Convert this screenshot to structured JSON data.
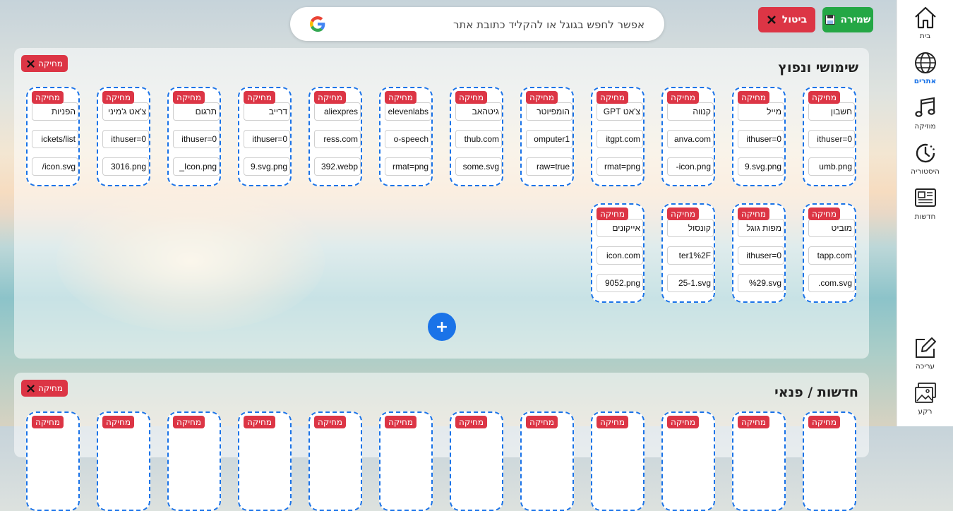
{
  "toolbar": {
    "save_label": "שמירה",
    "cancel_label": "ביטול"
  },
  "search": {
    "placeholder": "אפשר לחפש בגוגל או להקליד כתובת אתר"
  },
  "sidebar": {
    "items": [
      {
        "label": "בית",
        "icon": "home-icon"
      },
      {
        "label": "אתרים",
        "icon": "globe-icon",
        "active": true
      },
      {
        "label": "מוזיקה",
        "icon": "music-icon"
      },
      {
        "label": "היסטוריה",
        "icon": "history-icon"
      },
      {
        "label": "חדשות",
        "icon": "news-icon"
      },
      {
        "label": "עריכה",
        "icon": "edit-icon"
      },
      {
        "label": "רקע",
        "icon": "image-icon"
      }
    ]
  },
  "delete_label": "מחיקה",
  "panels": [
    {
      "title": "שימושי ונפוץ",
      "delete_label": "מחיקה",
      "cards": [
        {
          "name": "חשבון",
          "url": "ithuser=0",
          "icon": "umb.png"
        },
        {
          "name": "מייל",
          "url": "ithuser=0",
          "icon": "9.svg.png"
        },
        {
          "name": "קנווה",
          "url": "anva.com",
          "icon": "-icon.png"
        },
        {
          "name": "צ'אט GPT",
          "url": "itgpt.com",
          "icon": "rmat=png"
        },
        {
          "name": "הומפיוטר",
          "url": "omputer1",
          "icon": "raw=true"
        },
        {
          "name": "גיטהאב",
          "url": "thub.com",
          "icon": "some.svg"
        },
        {
          "name": "elevenlabs",
          "url": "o-speech",
          "icon": "rmat=png"
        },
        {
          "name": "aliexpres",
          "url": "ress.com",
          "icon": "392.webp"
        },
        {
          "name": "דרייב",
          "url": "ithuser=0",
          "icon": "9.svg.png"
        },
        {
          "name": "תרגום",
          "url": "ithuser=0",
          "icon": "_Icon.png"
        },
        {
          "name": "צ'אט ג'מיני",
          "url": "ithuser=0",
          "icon": "3016.png"
        },
        {
          "name": "הפניות",
          "url": "ickets/list",
          "icon": "/icon.svg"
        },
        {
          "name": "מוביט",
          "url": "tapp.com",
          "icon": ".com.svg"
        },
        {
          "name": "מפות גוגל",
          "url": "ithuser=0",
          "icon": "%29.svg"
        },
        {
          "name": "קונסול",
          "url": "ter1%2F",
          "icon": "25-1.svg"
        },
        {
          "name": "אייקונים",
          "url": "icon.com",
          "icon": "9052.png"
        }
      ]
    },
    {
      "title": "חדשות / פנאי",
      "delete_label": "מחיקה",
      "cards": []
    }
  ],
  "colors": {
    "accent": "#1a73e8",
    "save": "#24a745",
    "danger": "#dc3545"
  }
}
